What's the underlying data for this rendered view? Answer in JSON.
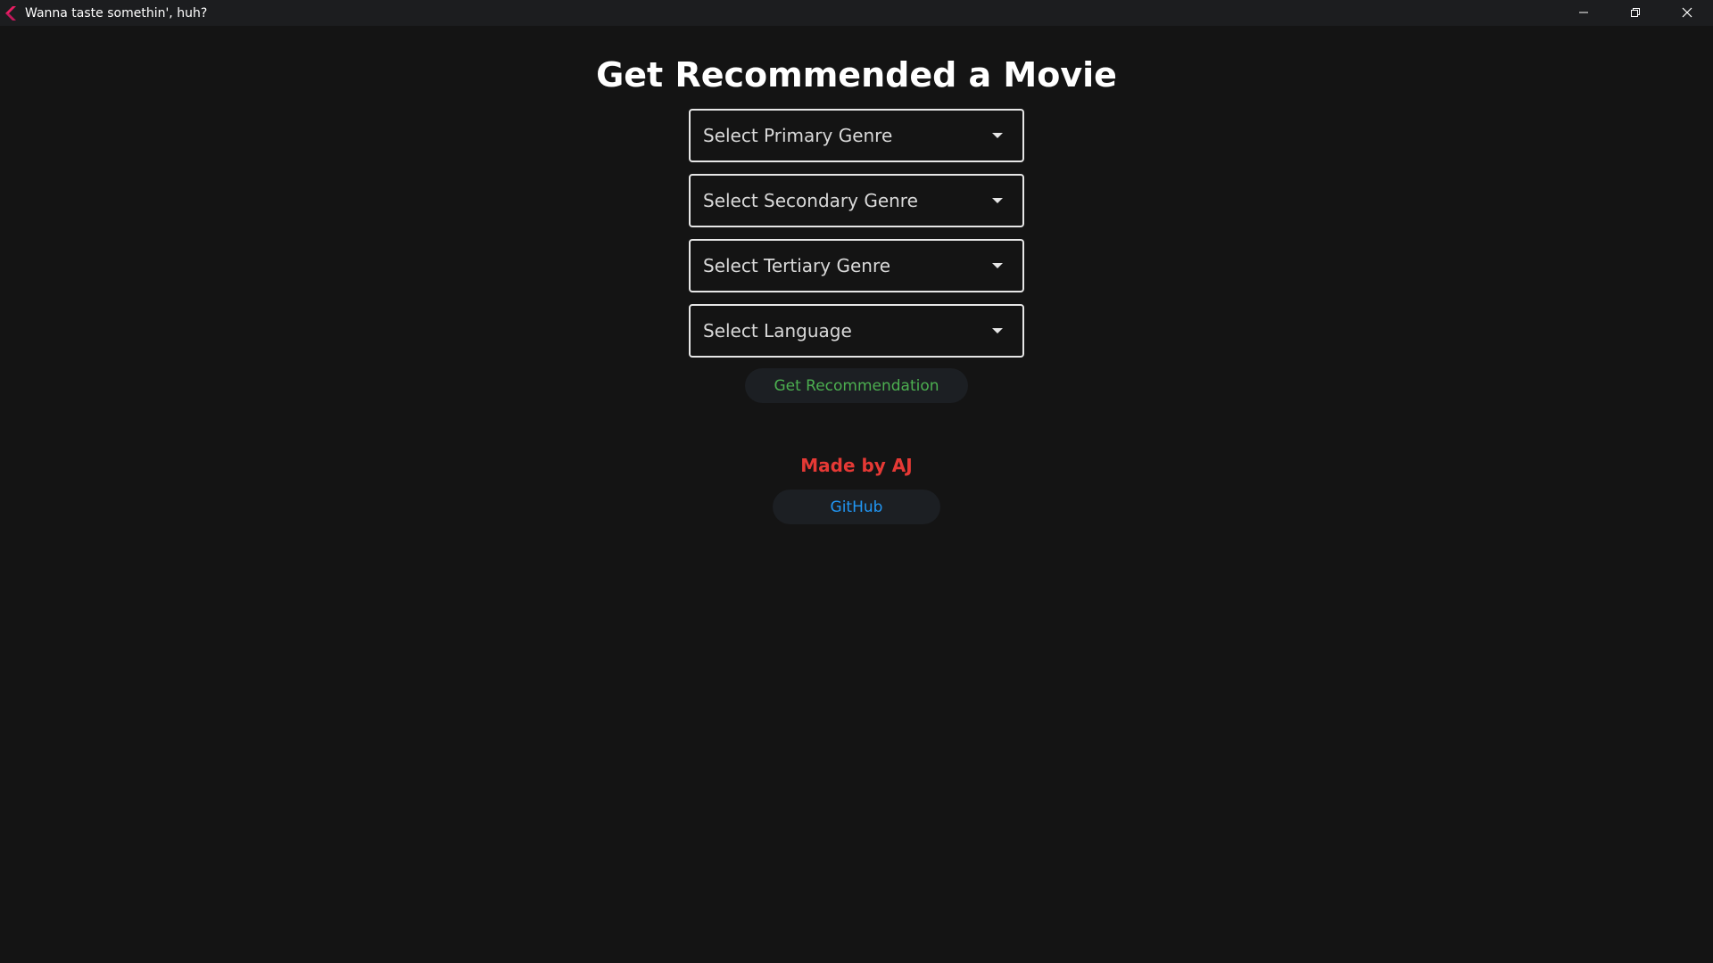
{
  "window": {
    "title": "Wanna taste somethin', huh?"
  },
  "icons": {
    "app": "flutter-app-icon",
    "minimize": "minimize-icon",
    "restore": "restore-icon",
    "close": "close-icon",
    "dropdown": "caret-down-icon"
  },
  "main": {
    "title": "Get Recommended a Movie",
    "dropdowns": [
      {
        "label": "Select Primary Genre"
      },
      {
        "label": "Select Secondary Genre"
      },
      {
        "label": "Select Tertiary Genre"
      },
      {
        "label": "Select Language"
      }
    ],
    "recommend_button": "Get Recommendation",
    "credit": "Made by AJ",
    "github_button": "GitHub"
  },
  "colors": {
    "background": "#141414",
    "titlebar": "#1c1d1f",
    "recommend_text": "#4caf50",
    "credit_text": "#e53935",
    "github_text": "#2196f3"
  }
}
